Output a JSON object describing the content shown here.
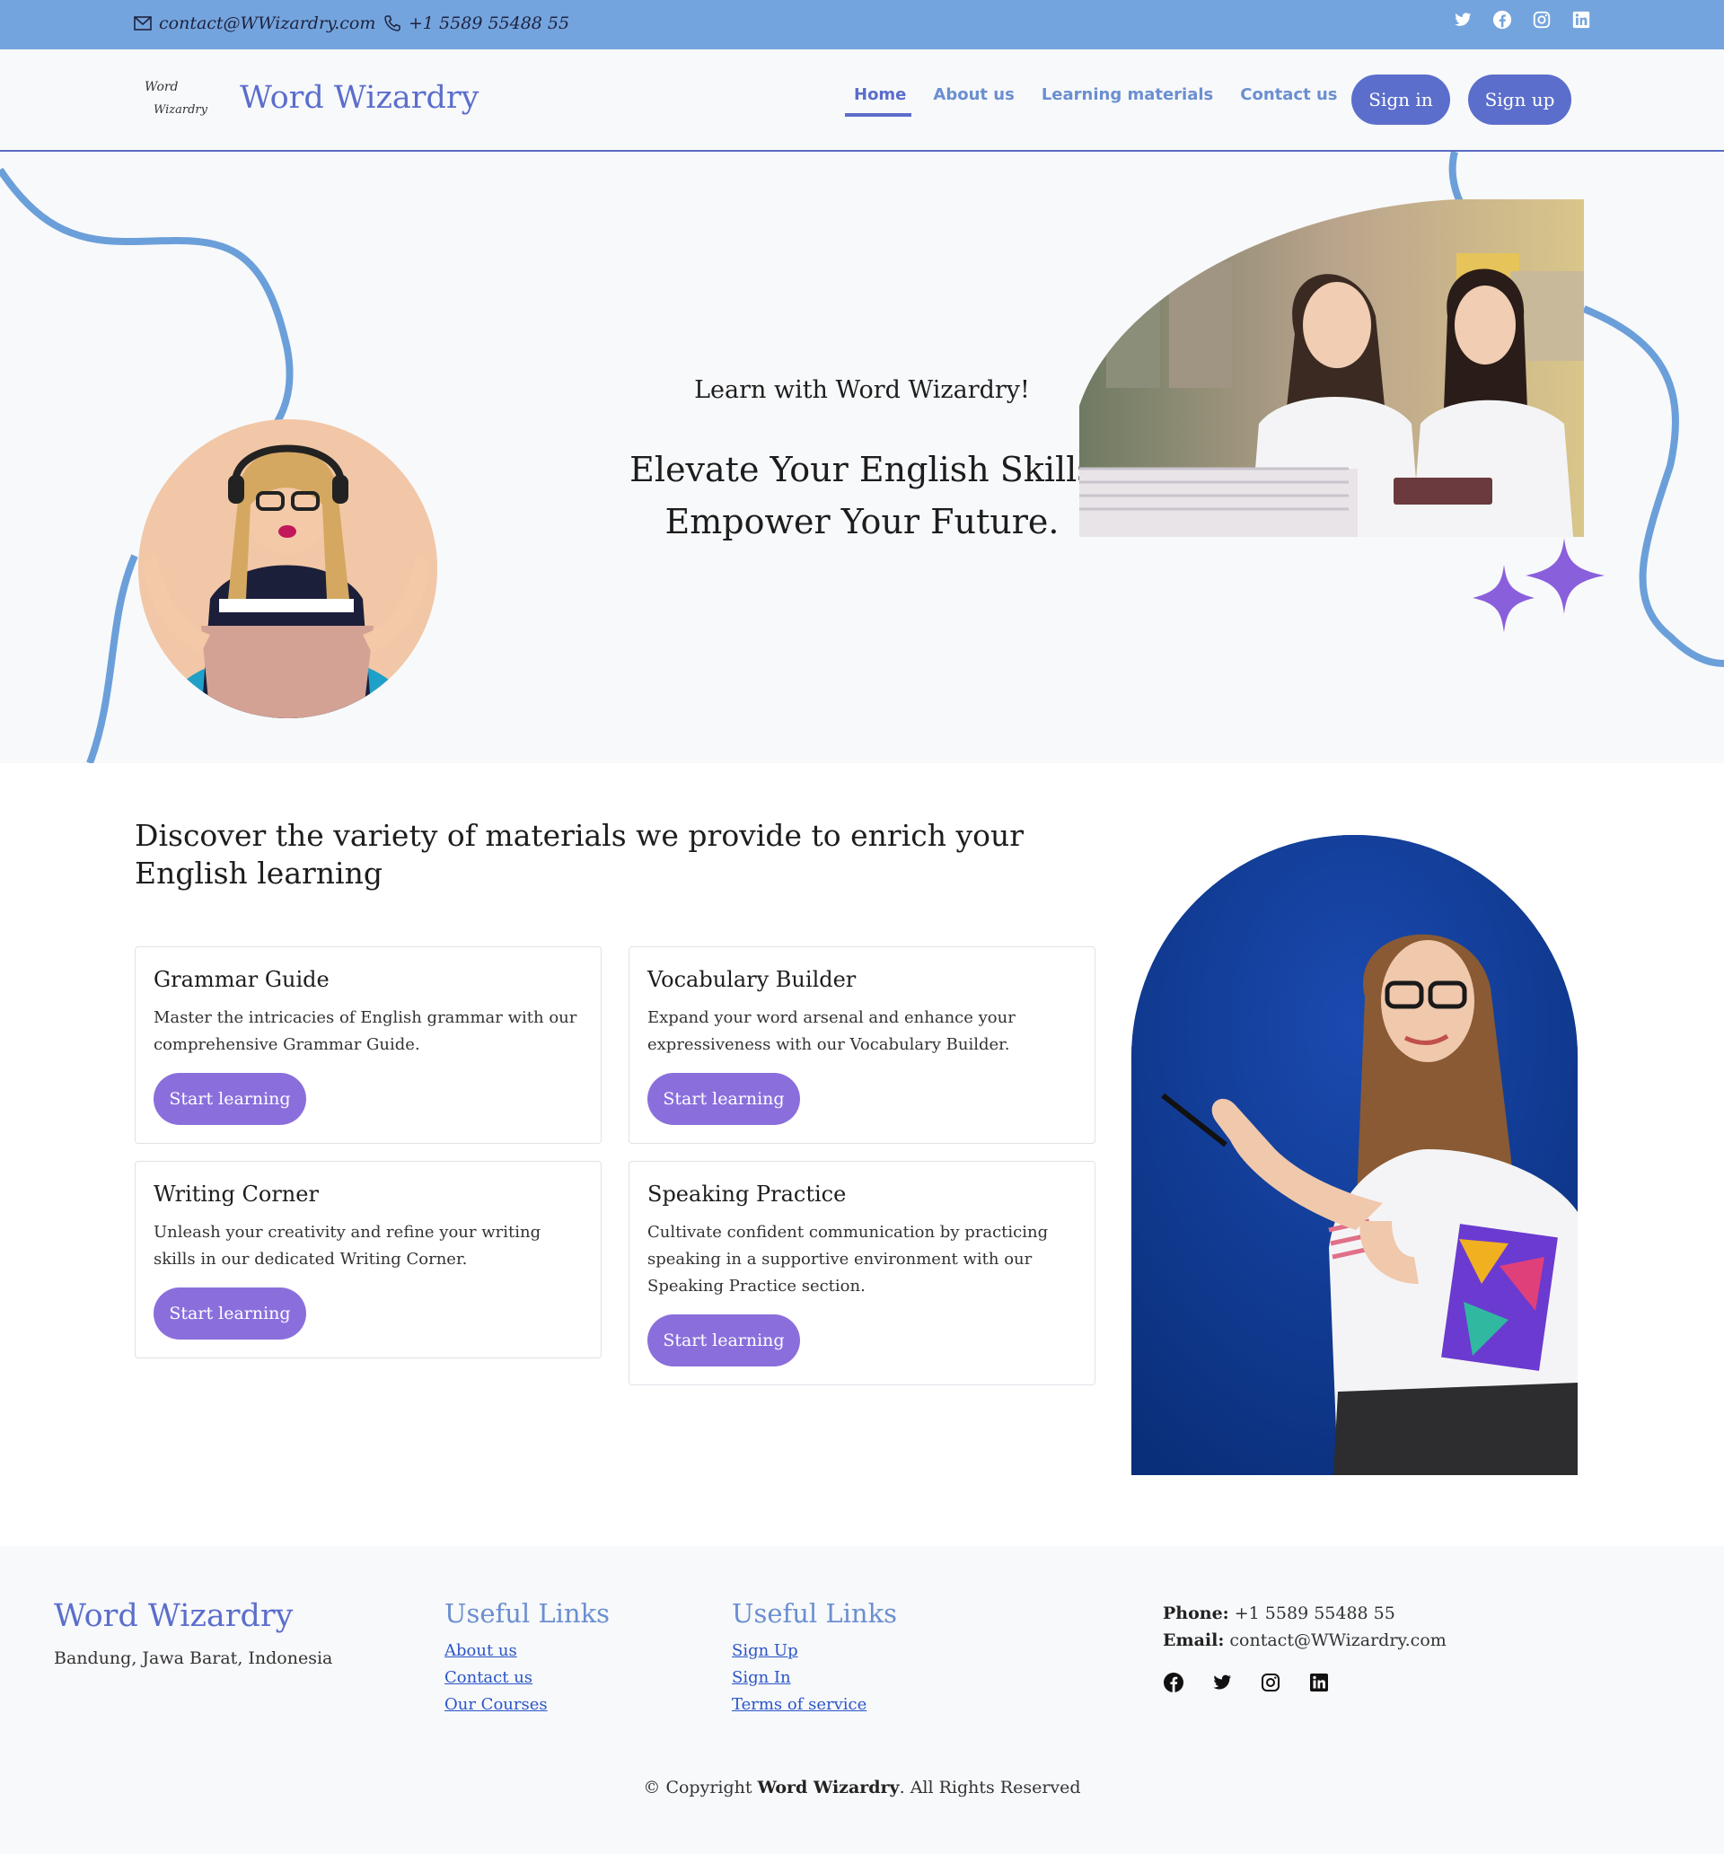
{
  "topbar": {
    "email": "contact@WWizardry.com",
    "phone": "+1 5589 55488 55",
    "social_icons": [
      "twitter-icon",
      "facebook-icon",
      "instagram-icon",
      "linkedin-icon"
    ]
  },
  "header": {
    "logo_line1": "Word",
    "logo_line2": "Wizardry",
    "brand": "Word Wizardry",
    "nav": [
      {
        "label": "Home",
        "active": true
      },
      {
        "label": "About us"
      },
      {
        "label": "Learning materials"
      },
      {
        "label": "Contact us"
      }
    ],
    "signin": "Sign in",
    "signup": "Sign up"
  },
  "hero": {
    "subtitle": "Learn with Word Wizardry!",
    "title_line1": "Elevate Your English Skills",
    "title_line2": "Empower Your Future."
  },
  "materials": {
    "title": "Discover the variety of materials we provide to enrich your English learning",
    "cards": [
      {
        "title": "Grammar Guide",
        "text": "Master the intricacies of English grammar with our comprehensive Grammar Guide.",
        "button": "Start learning"
      },
      {
        "title": "Vocabulary Builder",
        "text": "Expand your word arsenal and enhance your expressiveness with our Vocabulary Builder.",
        "button": "Start learning"
      },
      {
        "title": "Writing Corner",
        "text": "Unleash your creativity and refine your writing skills in our dedicated Writing Corner.",
        "button": "Start learning"
      },
      {
        "title": "Speaking Practice",
        "text": "Cultivate confident communication by practicing speaking in a supportive environment with our Speaking Practice section.",
        "button": "Start learning"
      }
    ]
  },
  "footer": {
    "brand": "Word Wizardry",
    "address": "Bandung, Jawa Barat, Indonesia",
    "col1": {
      "title": "Useful Links",
      "links": [
        "About us",
        "Contact us",
        "Our Courses"
      ]
    },
    "col2": {
      "title": "Useful Links",
      "links": [
        "Sign Up",
        "Sign In",
        "Terms of service"
      ]
    },
    "phone_label": "Phone:",
    "phone": "+1 5589 55488 55",
    "email_label": "Email:",
    "email": "contact@WWizardry.com",
    "social_icons": [
      "facebook-icon",
      "twitter-icon",
      "instagram-icon",
      "linkedin-icon"
    ],
    "copyright_prefix": "© Copyright",
    "copyright_brand": "Word Wizardry",
    "copyright_suffix": ". All Rights Reserved"
  },
  "colors": {
    "topbar": "#74a4dd",
    "brand": "#5b6ecb",
    "accent_button": "#8a6fdc",
    "curve": "#6b9fda",
    "sparkle": "#8a5fdc"
  }
}
